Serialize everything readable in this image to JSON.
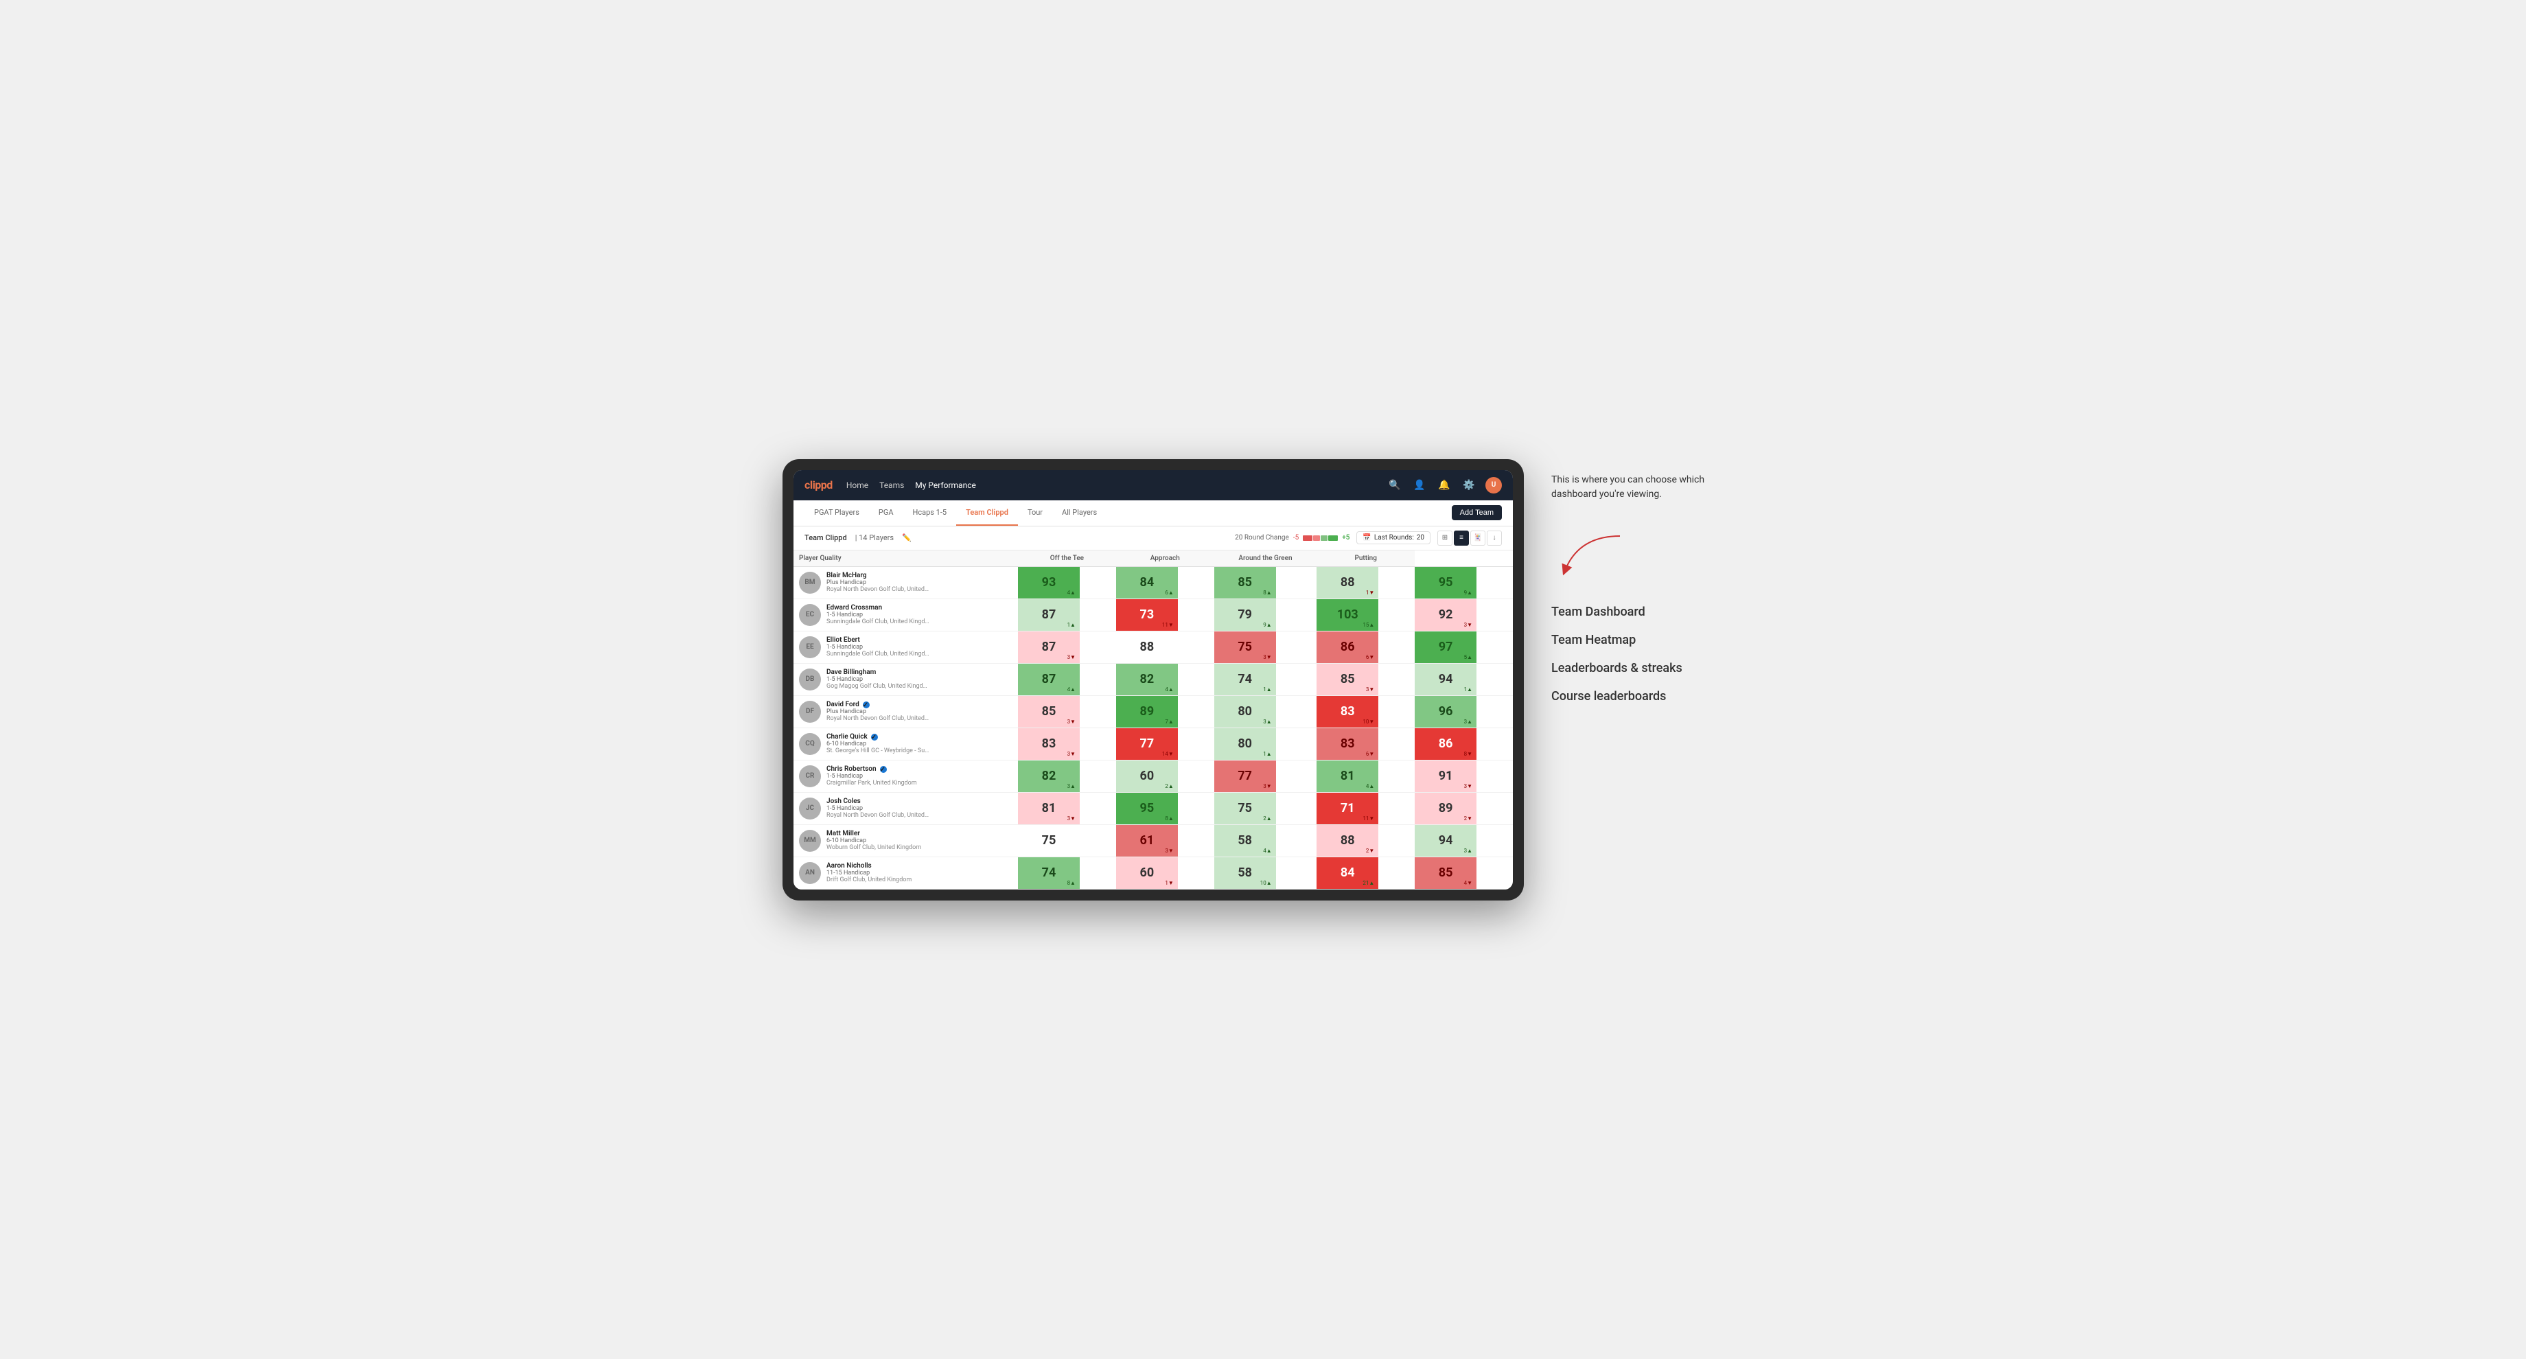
{
  "annotation": {
    "text": "This is where you can choose which dashboard you're viewing.",
    "arrow_label": "arrow pointing to view selector"
  },
  "menu": {
    "items": [
      {
        "label": "Team Dashboard"
      },
      {
        "label": "Team Heatmap"
      },
      {
        "label": "Leaderboards & streaks"
      },
      {
        "label": "Course leaderboards"
      }
    ]
  },
  "nav": {
    "logo": "clippd",
    "links": [
      {
        "label": "Home",
        "active": false
      },
      {
        "label": "Teams",
        "active": false
      },
      {
        "label": "My Performance",
        "active": true
      }
    ]
  },
  "tabs": [
    {
      "label": "PGAT Players",
      "active": false
    },
    {
      "label": "PGA",
      "active": false
    },
    {
      "label": "Hcaps 1-5",
      "active": false
    },
    {
      "label": "Team Clippd",
      "active": true
    },
    {
      "label": "Tour",
      "active": false
    },
    {
      "label": "All Players",
      "active": false
    }
  ],
  "add_team_btn": "Add Team",
  "toolbar": {
    "team_name": "Team Clippd",
    "separator": "|",
    "player_count": "14 Players",
    "round_change_label": "20 Round Change",
    "change_min": "-5",
    "change_max": "+5",
    "last_rounds_label": "Last Rounds:",
    "last_rounds_value": "20"
  },
  "table": {
    "headers": {
      "player": "Player Quality",
      "off_tee": "Off the Tee",
      "approach": "Approach",
      "around_green": "Around the Green",
      "putting": "Putting"
    },
    "players": [
      {
        "name": "Blair McHarg",
        "handicap": "Plus Handicap",
        "club": "Royal North Devon Golf Club, United Kingdom",
        "verified": false,
        "player_quality": {
          "value": "93",
          "change": "4",
          "dir": "up",
          "bg": "green-strong"
        },
        "off_tee": {
          "value": "84",
          "change": "6",
          "dir": "up",
          "bg": "green-medium"
        },
        "approach": {
          "value": "85",
          "change": "8",
          "dir": "up",
          "bg": "green-medium"
        },
        "around_green": {
          "value": "88",
          "change": "1",
          "dir": "down",
          "bg": "green-light"
        },
        "putting": {
          "value": "95",
          "change": "9",
          "dir": "up",
          "bg": "green-strong"
        }
      },
      {
        "name": "Edward Crossman",
        "handicap": "1-5 Handicap",
        "club": "Sunningdale Golf Club, United Kingdom",
        "verified": false,
        "player_quality": {
          "value": "87",
          "change": "1",
          "dir": "up",
          "bg": "green-light"
        },
        "off_tee": {
          "value": "73",
          "change": "11",
          "dir": "down",
          "bg": "red-strong"
        },
        "approach": {
          "value": "79",
          "change": "9",
          "dir": "up",
          "bg": "green-light"
        },
        "around_green": {
          "value": "103",
          "change": "15",
          "dir": "up",
          "bg": "green-strong"
        },
        "putting": {
          "value": "92",
          "change": "3",
          "dir": "down",
          "bg": "red-light"
        }
      },
      {
        "name": "Elliot Ebert",
        "handicap": "1-5 Handicap",
        "club": "Sunningdale Golf Club, United Kingdom",
        "verified": false,
        "player_quality": {
          "value": "87",
          "change": "3",
          "dir": "down",
          "bg": "red-light"
        },
        "off_tee": {
          "value": "88",
          "change": "",
          "dir": "neutral",
          "bg": "white"
        },
        "approach": {
          "value": "75",
          "change": "3",
          "dir": "down",
          "bg": "red-medium"
        },
        "around_green": {
          "value": "86",
          "change": "6",
          "dir": "down",
          "bg": "red-medium"
        },
        "putting": {
          "value": "97",
          "change": "5",
          "dir": "up",
          "bg": "green-strong"
        }
      },
      {
        "name": "Dave Billingham",
        "handicap": "1-5 Handicap",
        "club": "Gog Magog Golf Club, United Kingdom",
        "verified": false,
        "player_quality": {
          "value": "87",
          "change": "4",
          "dir": "up",
          "bg": "green-medium"
        },
        "off_tee": {
          "value": "82",
          "change": "4",
          "dir": "up",
          "bg": "green-medium"
        },
        "approach": {
          "value": "74",
          "change": "1",
          "dir": "up",
          "bg": "green-light"
        },
        "around_green": {
          "value": "85",
          "change": "3",
          "dir": "down",
          "bg": "red-light"
        },
        "putting": {
          "value": "94",
          "change": "1",
          "dir": "up",
          "bg": "green-light"
        }
      },
      {
        "name": "David Ford",
        "handicap": "Plus Handicap",
        "club": "Royal North Devon Golf Club, United Kingdom",
        "verified": true,
        "player_quality": {
          "value": "85",
          "change": "3",
          "dir": "down",
          "bg": "red-light"
        },
        "off_tee": {
          "value": "89",
          "change": "7",
          "dir": "up",
          "bg": "green-strong"
        },
        "approach": {
          "value": "80",
          "change": "3",
          "dir": "up",
          "bg": "green-light"
        },
        "around_green": {
          "value": "83",
          "change": "10",
          "dir": "down",
          "bg": "red-strong"
        },
        "putting": {
          "value": "96",
          "change": "3",
          "dir": "up",
          "bg": "green-medium"
        }
      },
      {
        "name": "Charlie Quick",
        "handicap": "6-10 Handicap",
        "club": "St. George's Hill GC - Weybridge - Surrey, Uni...",
        "verified": true,
        "player_quality": {
          "value": "83",
          "change": "3",
          "dir": "down",
          "bg": "red-light"
        },
        "off_tee": {
          "value": "77",
          "change": "14",
          "dir": "down",
          "bg": "red-strong"
        },
        "approach": {
          "value": "80",
          "change": "1",
          "dir": "up",
          "bg": "green-light"
        },
        "around_green": {
          "value": "83",
          "change": "6",
          "dir": "down",
          "bg": "red-medium"
        },
        "putting": {
          "value": "86",
          "change": "8",
          "dir": "down",
          "bg": "red-strong"
        }
      },
      {
        "name": "Chris Robertson",
        "handicap": "1-5 Handicap",
        "club": "Craigmillar Park, United Kingdom",
        "verified": true,
        "player_quality": {
          "value": "82",
          "change": "3",
          "dir": "up",
          "bg": "green-medium"
        },
        "off_tee": {
          "value": "60",
          "change": "2",
          "dir": "up",
          "bg": "green-light"
        },
        "approach": {
          "value": "77",
          "change": "3",
          "dir": "down",
          "bg": "red-medium"
        },
        "around_green": {
          "value": "81",
          "change": "4",
          "dir": "up",
          "bg": "green-medium"
        },
        "putting": {
          "value": "91",
          "change": "3",
          "dir": "down",
          "bg": "red-light"
        }
      },
      {
        "name": "Josh Coles",
        "handicap": "1-5 Handicap",
        "club": "Royal North Devon Golf Club, United Kingdom",
        "verified": false,
        "player_quality": {
          "value": "81",
          "change": "3",
          "dir": "down",
          "bg": "red-light"
        },
        "off_tee": {
          "value": "95",
          "change": "8",
          "dir": "up",
          "bg": "green-strong"
        },
        "approach": {
          "value": "75",
          "change": "2",
          "dir": "up",
          "bg": "green-light"
        },
        "around_green": {
          "value": "71",
          "change": "11",
          "dir": "down",
          "bg": "red-strong"
        },
        "putting": {
          "value": "89",
          "change": "2",
          "dir": "down",
          "bg": "red-light"
        }
      },
      {
        "name": "Matt Miller",
        "handicap": "6-10 Handicap",
        "club": "Woburn Golf Club, United Kingdom",
        "verified": false,
        "player_quality": {
          "value": "75",
          "change": "",
          "dir": "neutral",
          "bg": "white"
        },
        "off_tee": {
          "value": "61",
          "change": "3",
          "dir": "down",
          "bg": "red-medium"
        },
        "approach": {
          "value": "58",
          "change": "4",
          "dir": "up",
          "bg": "green-light"
        },
        "around_green": {
          "value": "88",
          "change": "2",
          "dir": "down",
          "bg": "red-light"
        },
        "putting": {
          "value": "94",
          "change": "3",
          "dir": "up",
          "bg": "green-light"
        }
      },
      {
        "name": "Aaron Nicholls",
        "handicap": "11-15 Handicap",
        "club": "Drift Golf Club, United Kingdom",
        "verified": false,
        "player_quality": {
          "value": "74",
          "change": "8",
          "dir": "up",
          "bg": "green-medium"
        },
        "off_tee": {
          "value": "60",
          "change": "1",
          "dir": "down",
          "bg": "red-light"
        },
        "approach": {
          "value": "58",
          "change": "10",
          "dir": "up",
          "bg": "green-light"
        },
        "around_green": {
          "value": "84",
          "change": "21",
          "dir": "up",
          "bg": "red-strong"
        },
        "putting": {
          "value": "85",
          "change": "4",
          "dir": "down",
          "bg": "red-medium"
        }
      }
    ]
  }
}
